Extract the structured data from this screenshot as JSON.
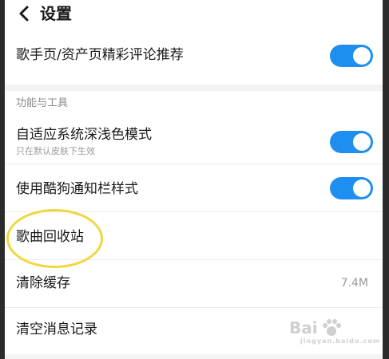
{
  "header": {
    "title": "设置",
    "back_icon": "chevron-left-icon"
  },
  "settings_top": {
    "comment_recommend": {
      "label": "歌手页/资产页精彩评论推荐",
      "on": true
    }
  },
  "tools_section": {
    "title": "功能与工具",
    "adaptive_dark_mode": {
      "label": "自适应系统深浅色模式",
      "sublabel": "只在默认皮肤下生效",
      "on": true
    },
    "notification_style": {
      "label": "使用酷狗通知栏样式",
      "on": true
    },
    "recycle_bin": {
      "label": "歌曲回收站"
    },
    "clear_cache": {
      "label": "清除缓存",
      "value": "7.4M"
    },
    "clear_messages": {
      "label": "清空消息记录"
    }
  },
  "annotation": {
    "highlight_color": "#f1d63c"
  },
  "colors": {
    "toggle_on": "#1e8ff0",
    "background": "#f3f3f5"
  },
  "watermark": {
    "logo_text": "Bai",
    "sub_text": "jingyan.baidu.com"
  }
}
